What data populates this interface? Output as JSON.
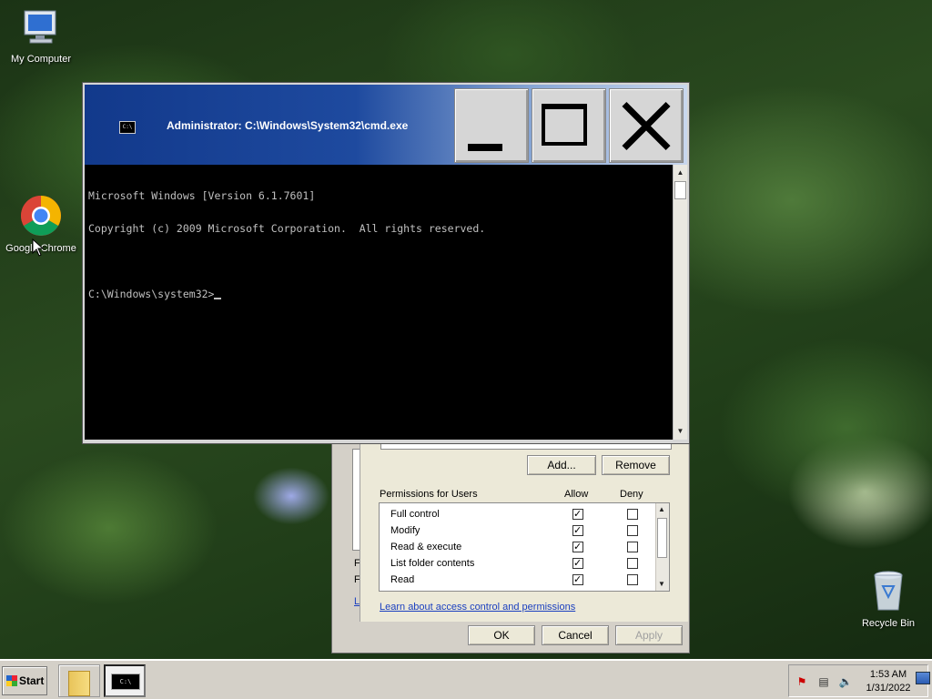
{
  "desktop": {
    "icons": [
      {
        "label": "My Computer",
        "icon": "computer-icon"
      },
      {
        "label": "Google Chrome",
        "icon": "chrome-icon"
      },
      {
        "label": "Recycle Bin",
        "icon": "recycle-bin-icon"
      }
    ]
  },
  "cmd_window": {
    "title": "Administrator: C:\\Windows\\System32\\cmd.exe",
    "icon_text": "C:\\",
    "lines": [
      "Microsoft Windows [Version 6.1.7601]",
      "Copyright (c) 2009 Microsoft Corporation.  All rights reserved.",
      "",
      "C:\\Windows\\system32>"
    ]
  },
  "permissions_dialog": {
    "add_label": "Add...",
    "remove_label": "Remove",
    "permissions_for": "Permissions for Users",
    "allow_header": "Allow",
    "deny_header": "Deny",
    "rows": [
      {
        "name": "Full control",
        "allow": true,
        "deny": false
      },
      {
        "name": "Modify",
        "allow": true,
        "deny": false
      },
      {
        "name": "Read & execute",
        "allow": true,
        "deny": false
      },
      {
        "name": "List folder contents",
        "allow": true,
        "deny": false
      },
      {
        "name": "Read",
        "allow": true,
        "deny": false
      }
    ],
    "left_letter_1": "F",
    "left_letter_2": "F",
    "left_letter_3": "L",
    "learn_link": "Learn about access control and permissions",
    "ok_label": "OK",
    "cancel_label": "Cancel",
    "apply_label": "Apply"
  },
  "taskbar": {
    "start_label": "Start",
    "time": "1:53 AM",
    "date": "1/31/2022"
  }
}
